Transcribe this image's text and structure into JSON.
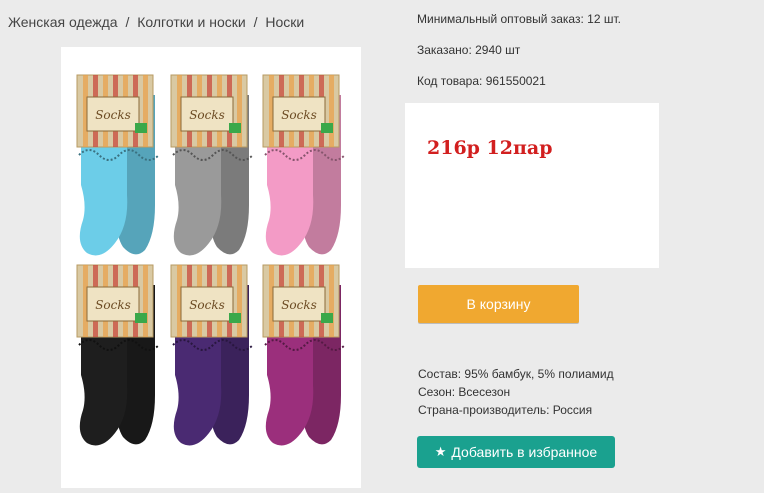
{
  "breadcrumb": {
    "items": [
      "Женская одежда",
      "Колготки и носки",
      "Носки"
    ],
    "separator": "/"
  },
  "product": {
    "min_order": "Минимальный оптовый заказ: 12 шт.",
    "ordered": "Заказано: 2940 шт",
    "code": "Код товара: 961550021",
    "price": "216р 12пар"
  },
  "buttons": {
    "cart": "В корзину",
    "favorite": "Добавить в избранное",
    "favorite_icon": "star-icon"
  },
  "specs": {
    "composition": "Состав: 95% бамбук, 5% полиамид",
    "season": "Сезон: Всесезон",
    "country": "Страна-производитель: Россия"
  },
  "image": {
    "tag_text": "Socks",
    "sock_colors": [
      "#6ccde8",
      "#9a9a9a",
      "#f39bc6",
      "#1e1e1e",
      "#4a2a72",
      "#9b2f7c"
    ]
  },
  "colors": {
    "cart_button": "#f0a830",
    "favorite_button": "#1aa18f",
    "price": "#d21f1f"
  }
}
